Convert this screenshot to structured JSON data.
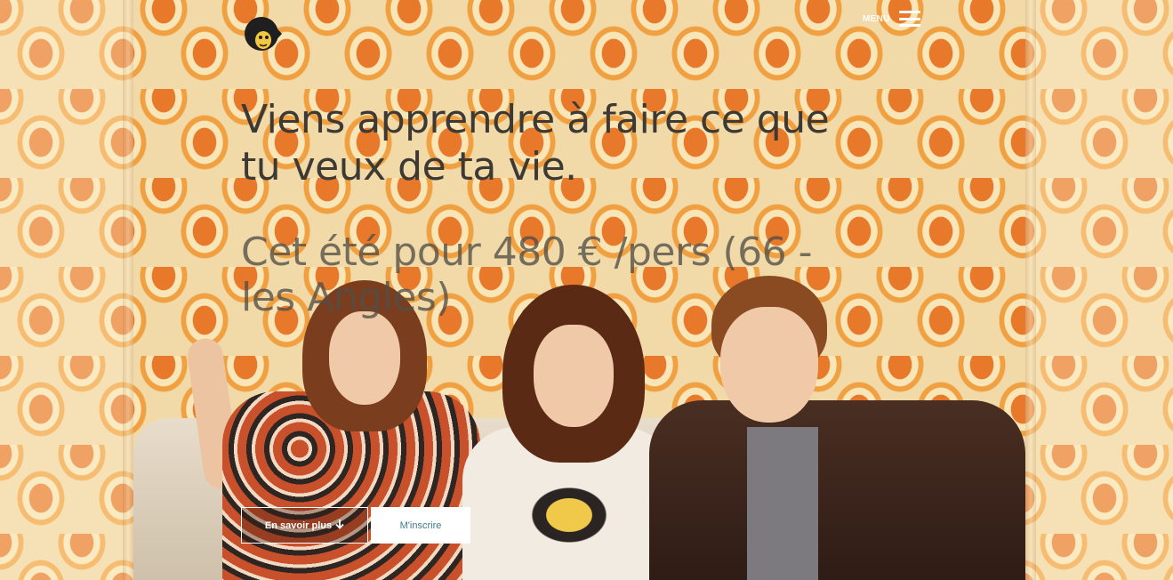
{
  "header": {
    "logo_icon": "mascot-logo-icon",
    "menu_label": "MENU",
    "menu_icon": "hamburger-icon"
  },
  "hero": {
    "headline": "Viens apprendre à faire ce que tu veux de ta vie.",
    "subline": "Cet été pour 480 € /pers (66 - les Angles)"
  },
  "actions": {
    "learn_more_label": "En savoir plus",
    "learn_more_icon": "arrow-down-icon",
    "signup_label": "M'inscrire"
  },
  "colors": {
    "headline": "#3d3a35",
    "button_text": "#3d7a8c",
    "wallpaper_orange": "#e8782a"
  }
}
